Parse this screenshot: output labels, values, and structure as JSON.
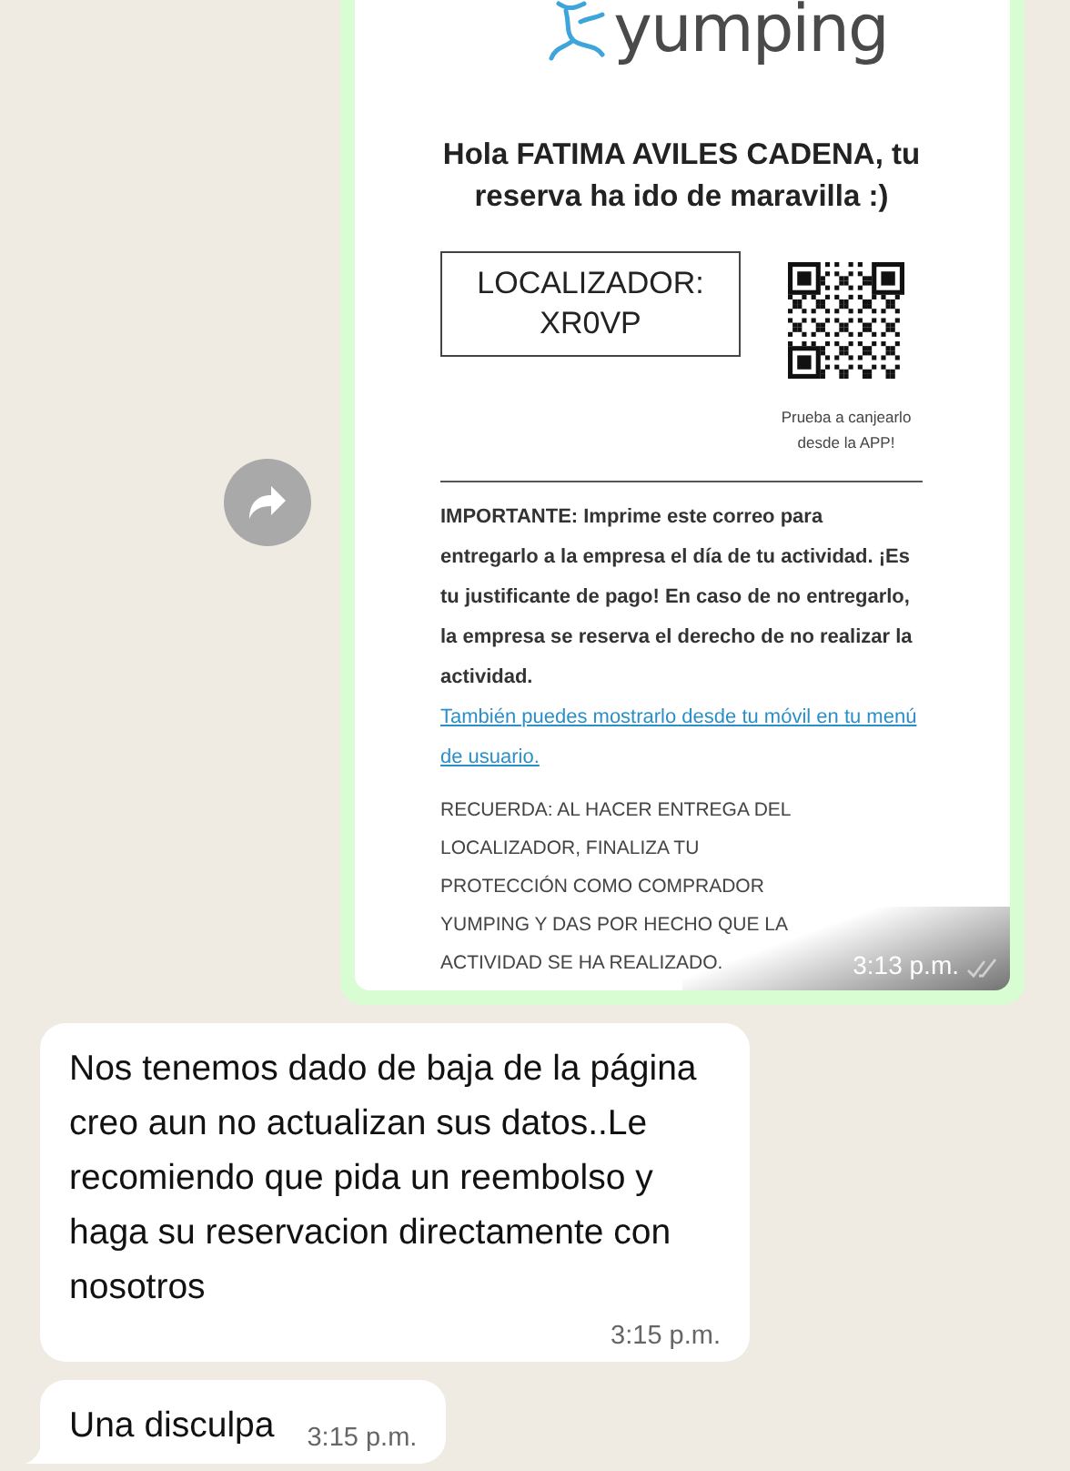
{
  "chat": {
    "messages": [
      {
        "kind": "image",
        "email": {
          "logo": "yumping",
          "heading": "Hola FATIMA AVILES CADENA, tu reserva ha ido de maravilla :)",
          "locator_label": "LOCALIZADOR:",
          "locator_code": "XR0VP",
          "qr_caption": "Prueba a canjearlo desde la APP!",
          "notice": "IMPORTANTE: Imprime este correo para entregarlo a la empresa el día de tu actividad. ¡Es tu justificante de pago! En caso de no entregarlo, la empresa se reserva el derecho de no realizar la actividad.",
          "notice_link": "También puedes mostrarlo desde tu móvil en tu menú de usuario.",
          "reminder": "RECUERDA: AL HACER ENTREGA DEL LOCALIZADOR, FINALIZA TU PROTECCIÓN COMO COMPRADOR YUMPING Y DAS POR HECHO QUE LA ACTIVIDAD SE HA REALIZADO."
        },
        "time": "3:13 p.m.",
        "read": false
      },
      {
        "kind": "text",
        "text": "Nos tenemos dado de baja de la página creo aun no actualizan sus datos..Le recomiendo que pida un reembolso y haga su reservacion directamente con nosotros",
        "time": "3:15 p.m.",
        "tail": false
      },
      {
        "kind": "text",
        "text": "Una disculpa",
        "time": "3:15 p.m.",
        "tail": true
      }
    ]
  }
}
